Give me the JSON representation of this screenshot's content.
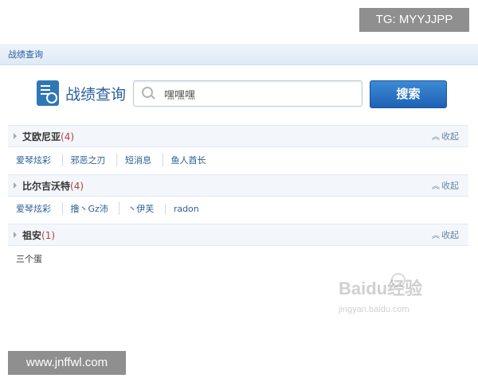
{
  "watermarks": {
    "tg": "TG: MYYJJPP",
    "website": "www.jnffwl.com",
    "baidu_main": "Baidu经验",
    "baidu_sub": "jingyan.baidu.com"
  },
  "topbar": {
    "title": "战绩查询"
  },
  "search": {
    "title": "战绩查询",
    "value": "嘿嘿嘿",
    "button_label": "搜索"
  },
  "groups": [
    {
      "name": "艾欧尼亚",
      "count": "(4)",
      "collapse_label": "收起",
      "members": [
        "爱琴炫彩",
        "邪恶之刃",
        "短消息",
        "鱼人酋长"
      ]
    },
    {
      "name": "比尔吉沃特",
      "count": "(4)",
      "collapse_label": "收起",
      "members": [
        "爱琴炫彩",
        "撸丶Gz沛",
        "丶伊芙",
        "radon"
      ]
    },
    {
      "name": "祖安",
      "count": "(1)",
      "collapse_label": "收起",
      "members": [
        "三个蛋"
      ]
    }
  ]
}
